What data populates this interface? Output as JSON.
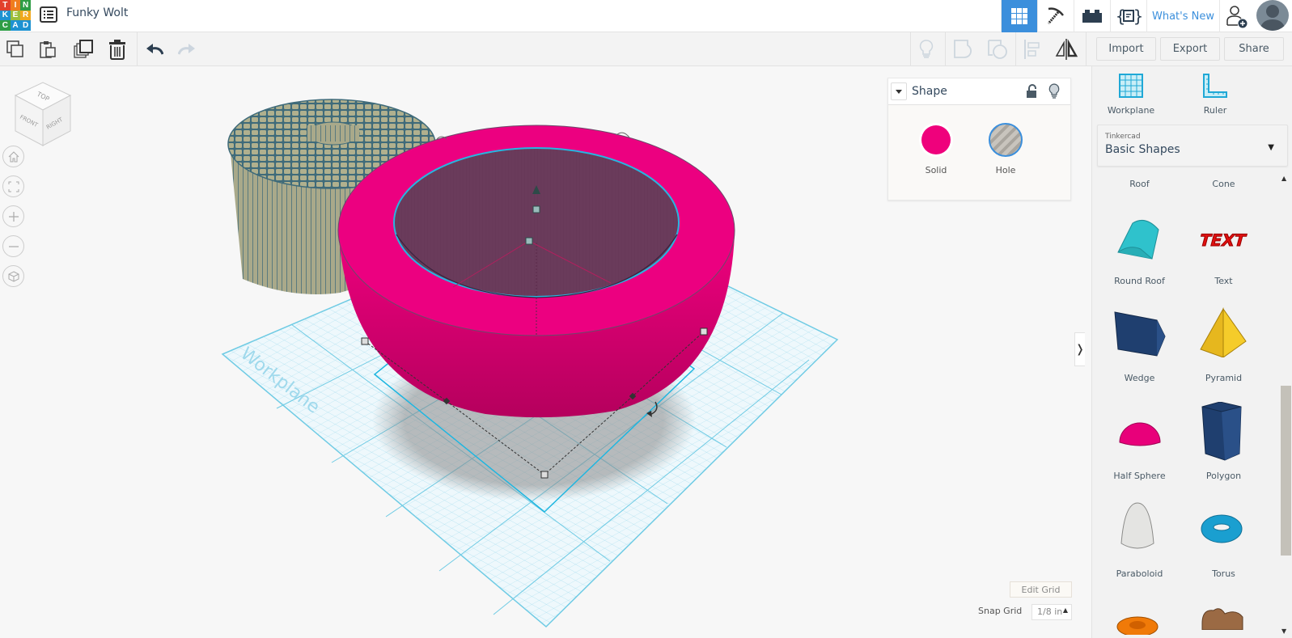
{
  "app": {
    "logo_letters": [
      "T",
      "I",
      "N",
      "K",
      "E",
      "R",
      "C",
      "A",
      "D"
    ],
    "logo_colors": [
      "#e2402c",
      "#f07d1e",
      "#2e9d45",
      "#1d92d1",
      "#9cbe3a",
      "#f0a81e",
      "#2e9d45",
      "#1d92d1",
      "#1d92d1"
    ],
    "project_title": "Funky Wolt"
  },
  "topbar": {
    "whats_new": "What's New",
    "buttons": [
      "3D Design",
      "Blocks",
      "Bricks",
      "Codeblocks"
    ]
  },
  "toolbar": {
    "import_label": "Import",
    "export_label": "Export",
    "share_label": "Share"
  },
  "viewcube": {
    "top": "TOP",
    "front": "FRONT",
    "right": "RIGHT"
  },
  "workplane_label": "Workplane",
  "inspector": {
    "title": "Shape",
    "solid_label": "Solid",
    "hole_label": "Hole",
    "solid_color": "#ef017c"
  },
  "grid": {
    "edit_grid_label": "Edit Grid",
    "snap_grid_label": "Snap Grid",
    "snap_grid_value": "1/8 in"
  },
  "panel": {
    "workplane_label": "Workplane",
    "ruler_label": "Ruler",
    "library_vendor": "Tinkercad",
    "library_name": "Basic Shapes",
    "shapes": [
      {
        "label": "Roof"
      },
      {
        "label": "Cone"
      },
      {
        "label": "Round Roof"
      },
      {
        "label": "Text"
      },
      {
        "label": "Wedge"
      },
      {
        "label": "Pyramid"
      },
      {
        "label": "Half Sphere"
      },
      {
        "label": "Polygon"
      },
      {
        "label": "Paraboloid"
      },
      {
        "label": "Torus"
      }
    ]
  },
  "colors": {
    "accent": "#3b8fdc",
    "shape_pink": "#e6007a",
    "grid": "#6fcbe4"
  }
}
